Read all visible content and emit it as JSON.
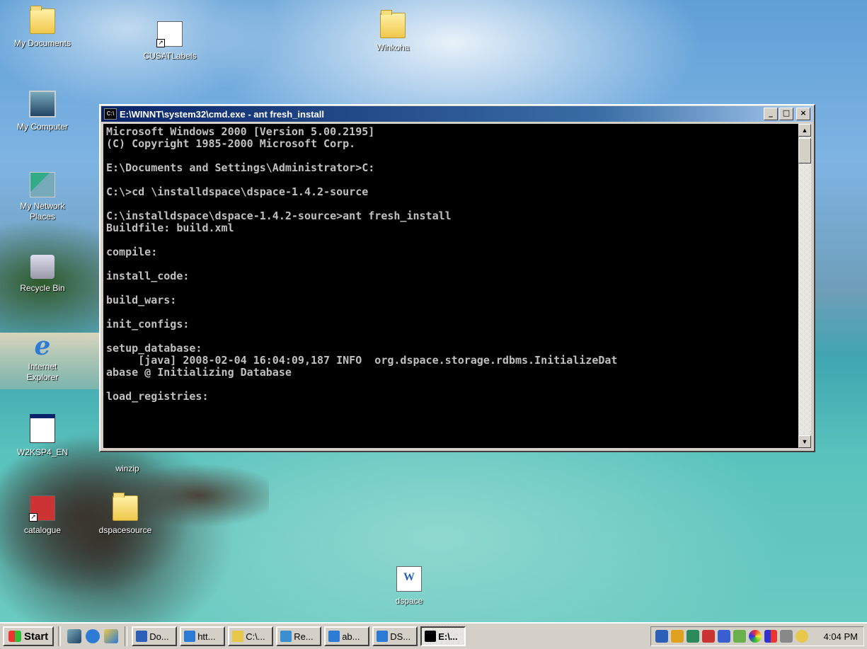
{
  "desktop": {
    "icons": [
      {
        "id": "my-documents",
        "label": "My Documents"
      },
      {
        "id": "cusat-labels",
        "label": "CUSATLabels"
      },
      {
        "id": "winkoha",
        "label": "Winkoha"
      },
      {
        "id": "my-computer",
        "label": "My Computer"
      },
      {
        "id": "my-network-places",
        "label": "My Network Places"
      },
      {
        "id": "recycle-bin",
        "label": "Recycle Bin"
      },
      {
        "id": "internet-explorer",
        "label": "Internet Explorer"
      },
      {
        "id": "w2ksp4",
        "label": "W2KSP4_EN"
      },
      {
        "id": "winzip",
        "label": "winzip"
      },
      {
        "id": "catalogue",
        "label": "catalogue"
      },
      {
        "id": "dspacesource",
        "label": "dspacesource"
      },
      {
        "id": "dspace",
        "label": "dspace"
      }
    ]
  },
  "cmd_window": {
    "title": "E:\\WINNT\\system32\\cmd.exe - ant fresh_install",
    "lines": [
      "Microsoft Windows 2000 [Version 5.00.2195]",
      "(C) Copyright 1985-2000 Microsoft Corp.",
      "",
      "E:\\Documents and Settings\\Administrator>C:",
      "",
      "C:\\>cd \\installdspace\\dspace-1.4.2-source",
      "",
      "C:\\installdspace\\dspace-1.4.2-source>ant fresh_install",
      "Buildfile: build.xml",
      "",
      "compile:",
      "",
      "install_code:",
      "",
      "build_wars:",
      "",
      "init_configs:",
      "",
      "setup_database:",
      "     [java] 2008-02-04 16:04:09,187 INFO  org.dspace.storage.rdbms.InitializeDat",
      "abase @ Initializing Database",
      "",
      "load_registries:"
    ]
  },
  "taskbar": {
    "start_label": "Start",
    "buttons": [
      {
        "label": "Do...",
        "color": "#2b5fb8"
      },
      {
        "label": "htt...",
        "color": "#2e7bd6"
      },
      {
        "label": "C:\\...",
        "color": "#e8c84a"
      },
      {
        "label": "Re...",
        "color": "#3a8fd0"
      },
      {
        "label": "ab...",
        "color": "#2e7bd6"
      },
      {
        "label": "DS...",
        "color": "#2e7bd6"
      },
      {
        "label": "E:\\...",
        "color": "#000000"
      }
    ],
    "clock": "4:04 PM"
  }
}
